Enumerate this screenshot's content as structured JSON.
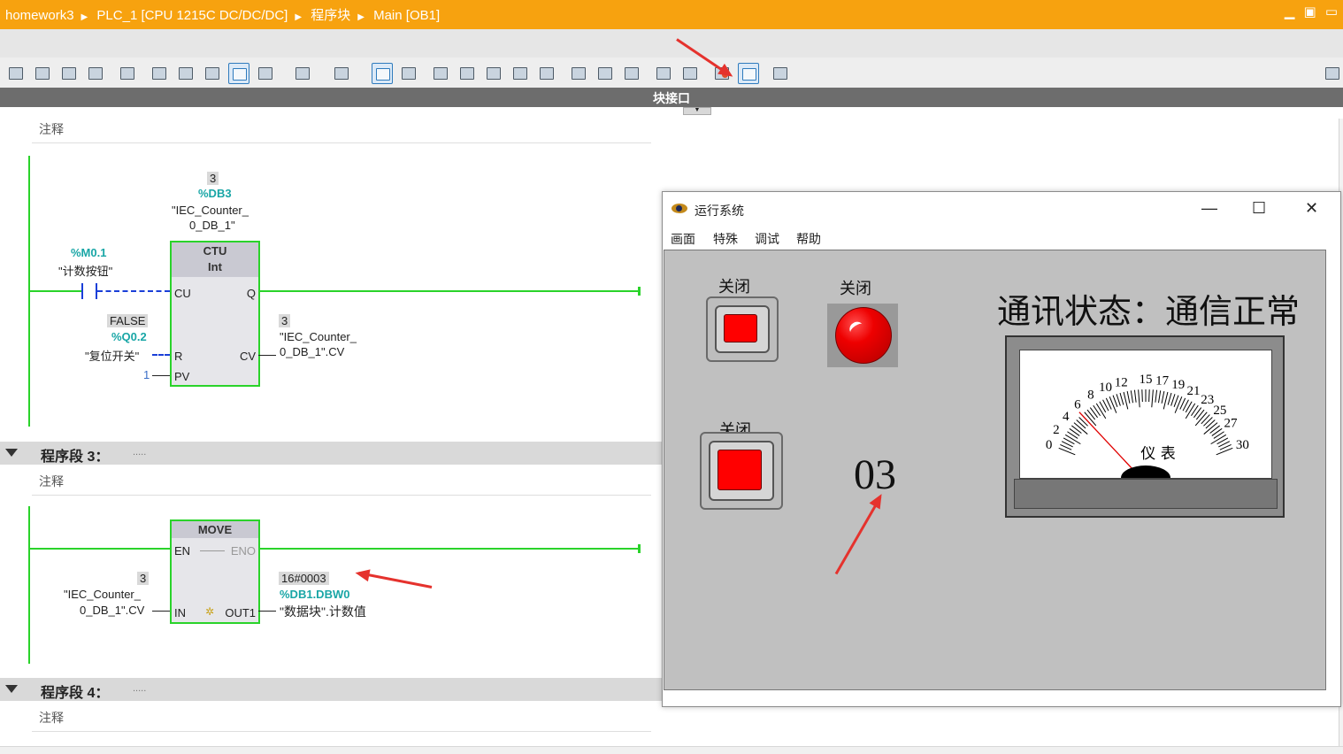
{
  "titlebar": {
    "crumbs": [
      "homework3",
      "PLC_1 [CPU 1215C DC/DC/DC]",
      "程序块",
      "Main [OB1]"
    ],
    "win_controls": [
      "▁",
      "▣",
      "▭"
    ]
  },
  "interface_bar": {
    "label": "块接口"
  },
  "network2": {
    "comment": "注释",
    "instance": {
      "value": "3",
      "address": "%DB3",
      "name_l1": "\"IEC_Counter_",
      "name_l2": "0_DB_1\""
    },
    "contact": {
      "address": "%M0.1",
      "name": "\"计数按钮\""
    },
    "block": {
      "type": "CTU",
      "datatype": "Int",
      "pins": {
        "cu": "CU",
        "q": "Q",
        "r": "R",
        "cv": "CV",
        "pv": "PV"
      }
    },
    "reset": {
      "value": "FALSE",
      "address": "%Q0.2",
      "name": "\"复位开关\""
    },
    "pv_value": "1",
    "cv_out": {
      "value": "3",
      "name_l1": "\"IEC_Counter_",
      "name_l2": "0_DB_1\".CV"
    }
  },
  "network3": {
    "title": "程序段 3：",
    "dots": ".....",
    "comment": "注释",
    "block": {
      "type": "MOVE",
      "pins": {
        "en": "EN",
        "eno": "ENO",
        "in": "IN",
        "out1": "OUT1"
      }
    },
    "in_src": {
      "value": "3",
      "name_l1": "\"IEC_Counter_",
      "name_l2": "0_DB_1\".CV"
    },
    "out_dst": {
      "value": "16#0003",
      "address": "%DB1.DBW0",
      "name": "\"数据块\".计数值"
    }
  },
  "network4": {
    "title": "程序段 4：",
    "dots": ".....",
    "comment": "注释"
  },
  "runtime": {
    "title": "运行系统",
    "controls": {
      "minimize": "—",
      "maximize": "☐",
      "close": "✕"
    },
    "menu": [
      "画面",
      "特殊",
      "调试",
      "帮助"
    ],
    "button1_label": "关闭",
    "lamp_label": "关闭",
    "button2_label": "关闭",
    "count_display": "03",
    "status_text": "通讯状态：通信正常",
    "meter": {
      "label": "仪 表",
      "ticks": [
        "0",
        "2",
        "4",
        "6",
        "8",
        "10",
        "12",
        "15",
        "17",
        "19",
        "21",
        "23",
        "25",
        "27",
        "30"
      ],
      "value": 5.5,
      "min": 0,
      "max": 30
    }
  }
}
